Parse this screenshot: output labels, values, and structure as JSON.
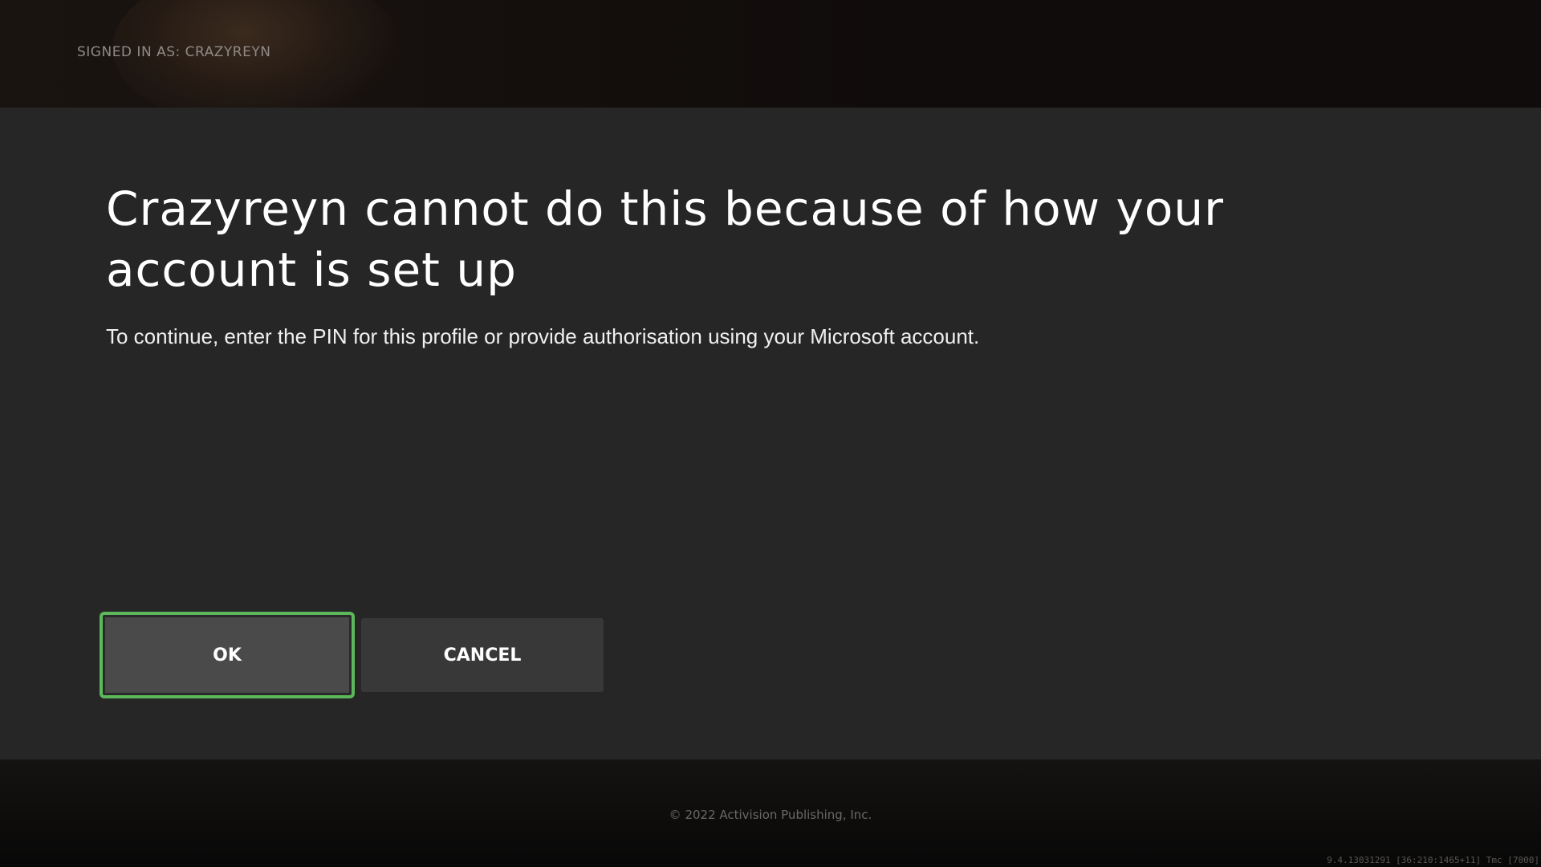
{
  "header": {
    "signed_in_label": "SIGNED IN AS: CRAZYREYN"
  },
  "dialog": {
    "title": "Crazyreyn cannot do this because of how your account is set up",
    "message": "To continue, enter the PIN for this profile or provide authorisation using your Microsoft account.",
    "buttons": {
      "ok_label": "OK",
      "cancel_label": "CANCEL"
    },
    "focused_button": "OK"
  },
  "footer": {
    "copyright": "© 2022 Activision Publishing, Inc.",
    "build_info": "9.4.13031291 [36:210:1465+11] Tmc [7000]"
  },
  "colors": {
    "dialog_background": "#262626",
    "focus_ring": "#5cb85a",
    "ok_button_background": "#4a4a4a",
    "cancel_button_background": "#383838",
    "text_primary": "#ffffff"
  }
}
